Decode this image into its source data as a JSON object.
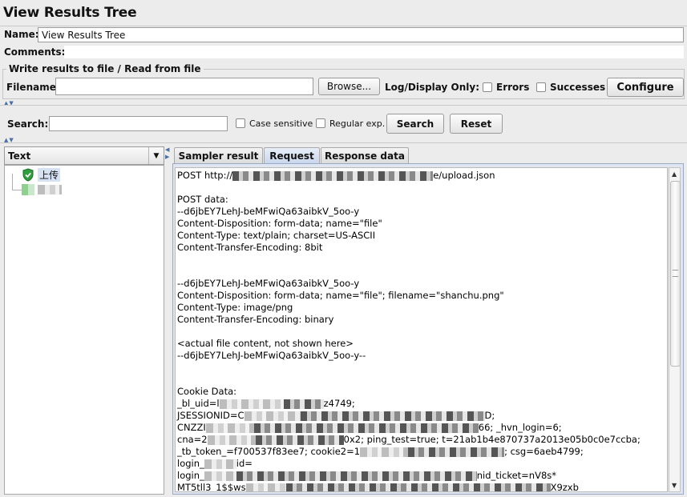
{
  "panel": {
    "title": "View Results Tree"
  },
  "name_row": {
    "label": "Name:",
    "value": "View Results Tree"
  },
  "comments_row": {
    "label": "Comments:"
  },
  "file_group": {
    "legend": "Write results to file / Read from file",
    "filename_label": "Filename",
    "filename_value": "",
    "browse_label": "Browse...",
    "log_display_label": "Log/Display Only:",
    "errors_label": "Errors",
    "successes_label": "Successes",
    "configure_label": "Configure"
  },
  "search": {
    "label": "Search:",
    "value": "",
    "case_sensitive_label": "Case sensitive",
    "regex_label": "Regular exp.",
    "search_button": "Search",
    "reset_button": "Reset"
  },
  "renderer": {
    "selected": "Text"
  },
  "tree": {
    "items": [
      {
        "label": "上传",
        "status": "success"
      }
    ]
  },
  "tabs": [
    {
      "label": "Sampler result",
      "active": false
    },
    {
      "label": "Request",
      "active": true
    },
    {
      "label": "Response data",
      "active": false
    }
  ],
  "request": {
    "url_prefix": "POST http://",
    "url_suffix": "e/upload.json",
    "lines_block1": [
      "",
      "POST data:",
      "--d6jbEY7LehJ-beMFwiQa63aibkV_5oo-y",
      "Content-Disposition: form-data; name=\"file\"",
      "Content-Type: text/plain; charset=US-ASCII",
      "Content-Transfer-Encoding: 8bit",
      "",
      "",
      "--d6jbEY7LehJ-beMFwiQa63aibkV_5oo-y",
      "Content-Disposition: form-data; name=\"file\"; filename=\"shanchu.png\"",
      "Content-Type: image/png",
      "Content-Transfer-Encoding: binary",
      "",
      "<actual file content, not shown here>",
      "--d6jbEY7LehJ-beMFwiQa63aibkV_5oo-y--",
      "",
      "",
      "Cookie Data:"
    ],
    "cookie_lines": [
      {
        "pre": "_bl_uid=l",
        "post": "z4749;"
      },
      {
        "pre": "JSESSIONID=C",
        "post": "D;"
      },
      {
        "pre": "CNZZI",
        "post": "66; _hvn_login=6;"
      },
      {
        "pre": "cna=2",
        "post": "0x2; ping_test=true; t=21ab1b4e870737a2013e05b0c0e7ccba;"
      },
      {
        "pre": "_tb_token_=f700537f83ee7; cookie2=1",
        "post": "; csg=6aeb4799;"
      },
      {
        "pre": "login_",
        "post": "id="
      },
      {
        "pre": "login_",
        "post": "nid_ticket=",
        "tail": "nV8s*"
      },
      {
        "pre": "MT5tll3_1$$ws",
        "post": "",
        "tail": "X9zxb"
      }
    ]
  }
}
